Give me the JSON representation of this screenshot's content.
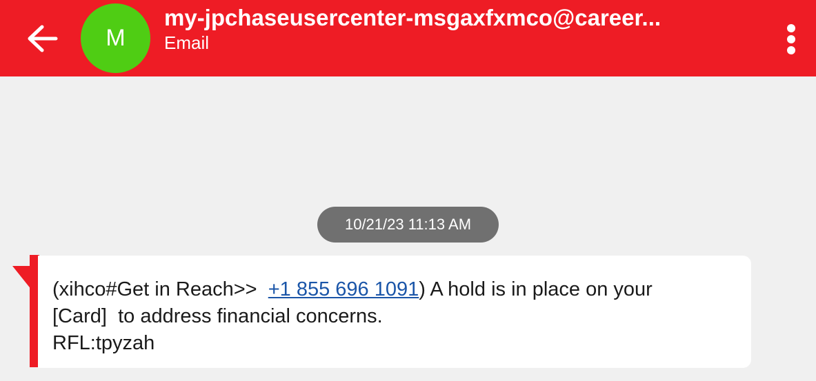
{
  "header": {
    "back_icon": "arrow-left-icon",
    "avatar_initial": "M",
    "contact_name": "my-jpchaseusercenter-msgaxfxmco@career...",
    "contact_type": "Email",
    "more_icon": "more-vert-icon"
  },
  "conversation": {
    "timestamp": "10/21/23 11:13 AM",
    "message": {
      "line1_prefix": "(xihco#Get in Reach>>  ",
      "phone_link": "+1 855 696 1091",
      "line1_suffix": ") A hold is in place on your",
      "line2": "[Card]  to address financial concerns.",
      "line3": "RFL:tpyzah"
    }
  },
  "colors": {
    "header_bg": "#ee1c25",
    "avatar_bg": "#4fcd14",
    "timestamp_bg": "#707070",
    "link": "#1a55a8"
  }
}
